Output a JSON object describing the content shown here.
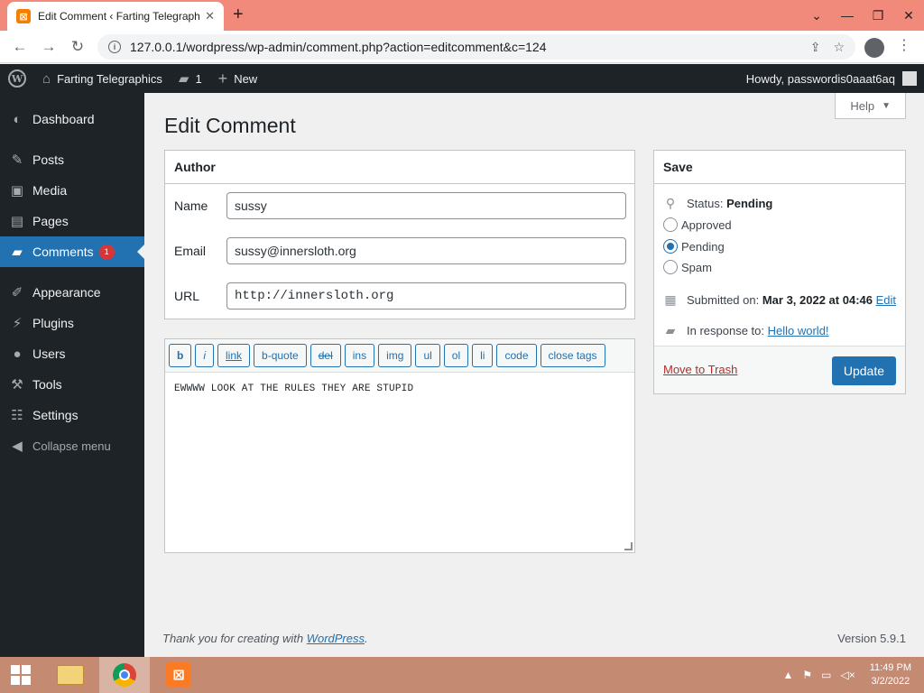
{
  "browser": {
    "tab_title": "Edit Comment ‹ Farting Telegraphics",
    "url": "127.0.0.1/wordpress/wp-admin/comment.php?action=editcomment&c=124"
  },
  "adminbar": {
    "site_name": "Farting Telegraphics",
    "comments_count": "1",
    "new_label": "New",
    "howdy": "Howdy, passwordis0aaat6aq"
  },
  "sidebar": {
    "items": [
      {
        "label": "Dashboard",
        "icon": "dashboard-icon"
      },
      {
        "label": "Posts",
        "icon": "pin-icon"
      },
      {
        "label": "Media",
        "icon": "media-icon"
      },
      {
        "label": "Pages",
        "icon": "pages-icon"
      },
      {
        "label": "Comments",
        "icon": "comment-icon",
        "badge": "1"
      },
      {
        "label": "Appearance",
        "icon": "brush-icon"
      },
      {
        "label": "Plugins",
        "icon": "plugin-icon"
      },
      {
        "label": "Users",
        "icon": "users-icon"
      },
      {
        "label": "Tools",
        "icon": "wrench-icon"
      },
      {
        "label": "Settings",
        "icon": "settings-icon"
      }
    ],
    "collapse": "Collapse menu"
  },
  "page": {
    "help": "Help",
    "title": "Edit Comment"
  },
  "author": {
    "heading": "Author",
    "name_label": "Name",
    "name_value": "sussy",
    "email_label": "Email",
    "email_value": "sussy@innersloth.org",
    "url_label": "URL",
    "url_value": "http://innersloth.org"
  },
  "editor": {
    "buttons": [
      "b",
      "i",
      "link",
      "b-quote",
      "del",
      "ins",
      "img",
      "ul",
      "ol",
      "li",
      "code",
      "close tags"
    ],
    "content": "EWWWW LOOK AT THE RULES THEY ARE STUPID"
  },
  "save": {
    "heading": "Save",
    "status_label": "Status:",
    "status_value": "Pending",
    "options": [
      "Approved",
      "Pending",
      "Spam"
    ],
    "selected": "Pending",
    "submitted_label": "Submitted on:",
    "submitted_value": "Mar 3, 2022 at 04:46",
    "edit_link": "Edit",
    "response_label": "In response to:",
    "response_link": "Hello world!",
    "trash": "Move to Trash",
    "update": "Update"
  },
  "footer": {
    "thanks_prefix": "Thank you for creating with",
    "thanks_link": "WordPress",
    "version": "Version 5.9.1"
  },
  "taskbar": {
    "time": "11:49 PM",
    "date": "3/2/2022"
  },
  "colors": {
    "accent": "#2271b1",
    "adminbar": "#1d2327",
    "badge": "#d63638",
    "tabstrip": "#f18a7b",
    "taskbar": "#c58a72"
  }
}
